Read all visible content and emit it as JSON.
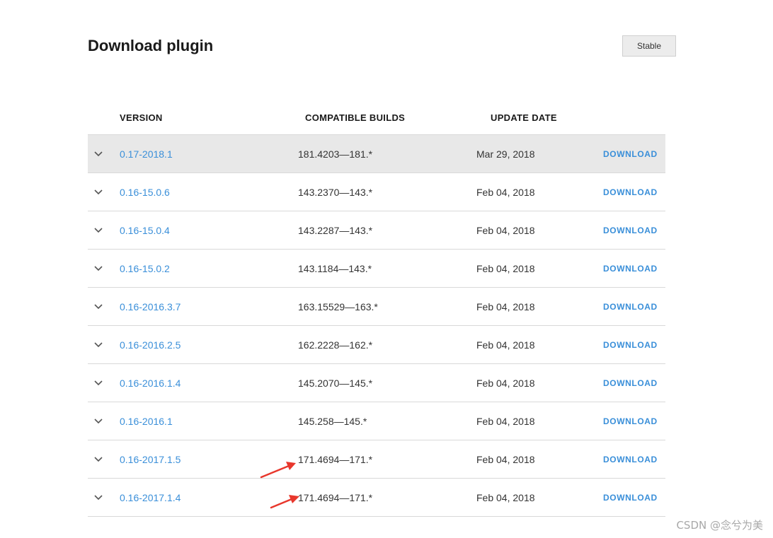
{
  "header": {
    "title": "Download plugin",
    "channel_button": "Stable"
  },
  "table": {
    "columns": [
      "VERSION",
      "COMPATIBLE BUILDS",
      "UPDATE DATE"
    ],
    "download_label": "DOWNLOAD",
    "rows": [
      {
        "version": "0.17-2018.1",
        "builds": "181.4203—181.*",
        "date": "Mar 29, 2018",
        "selected": true
      },
      {
        "version": "0.16-15.0.6",
        "builds": "143.2370—143.*",
        "date": "Feb 04, 2018",
        "selected": false
      },
      {
        "version": "0.16-15.0.4",
        "builds": "143.2287—143.*",
        "date": "Feb 04, 2018",
        "selected": false
      },
      {
        "version": "0.16-15.0.2",
        "builds": "143.1184—143.*",
        "date": "Feb 04, 2018",
        "selected": false
      },
      {
        "version": "0.16-2016.3.7",
        "builds": "163.15529—163.*",
        "date": "Feb 04, 2018",
        "selected": false
      },
      {
        "version": "0.16-2016.2.5",
        "builds": "162.2228—162.*",
        "date": "Feb 04, 2018",
        "selected": false
      },
      {
        "version": "0.16-2016.1.4",
        "builds": "145.2070—145.*",
        "date": "Feb 04, 2018",
        "selected": false
      },
      {
        "version": "0.16-2016.1",
        "builds": "145.258—145.*",
        "date": "Feb 04, 2018",
        "selected": false
      },
      {
        "version": "0.16-2017.1.5",
        "builds": "171.4694—171.*",
        "date": "Feb 04, 2018",
        "selected": false
      },
      {
        "version": "0.16-2017.1.4",
        "builds": "171.4694—171.*",
        "date": "Feb 04, 2018",
        "selected": false
      }
    ]
  },
  "annotations": {
    "arrow_color": "#e8372c",
    "arrow_icon": "red-arrow-icon"
  },
  "colors": {
    "link": "#3a8fd9",
    "selected_row": "#e8e8e8",
    "divider": "#d9d9d9"
  },
  "watermark": "CSDN @念兮为美"
}
